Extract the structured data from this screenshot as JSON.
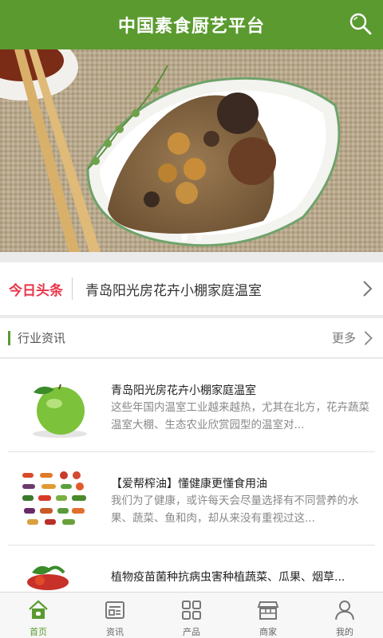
{
  "header": {
    "title": "中国素食厨艺平台",
    "search_icon": "search-icon"
  },
  "banner": {
    "slides": 2,
    "active": 1,
    "alt": ""
  },
  "headline": {
    "tag": "今日头条",
    "text": "青岛阳光房花卉小棚家庭温室"
  },
  "section": {
    "label": "行业资讯",
    "more": "更多"
  },
  "news": [
    {
      "title": "青岛阳光房花卉小棚家庭温室",
      "desc": "这些年国内温室工业越来越热，尤其在北方，花卉蔬菜温室大棚、生态农业欣赏园型的温室对..."
    },
    {
      "title": "【爱帮榨油】懂健康更懂食用油",
      "desc": "我们为了健康，或许每天会尽量选择有不同营养的水果、蔬菜、鱼和肉，却从来没有重视过这..."
    },
    {
      "title": "植物疫苗菌种抗病虫害种植蔬菜、瓜果、烟草...",
      "desc": ""
    }
  ],
  "tabs": [
    {
      "label": "首页",
      "icon": "home-icon",
      "active": true
    },
    {
      "label": "资讯",
      "icon": "news-icon",
      "active": false
    },
    {
      "label": "产品",
      "icon": "grid-icon",
      "active": false
    },
    {
      "label": "商家",
      "icon": "shop-icon",
      "active": false
    },
    {
      "label": "我的",
      "icon": "user-icon",
      "active": false
    }
  ],
  "colors": {
    "brand": "#5a9a2f",
    "headline_tag": "#e8354a"
  }
}
